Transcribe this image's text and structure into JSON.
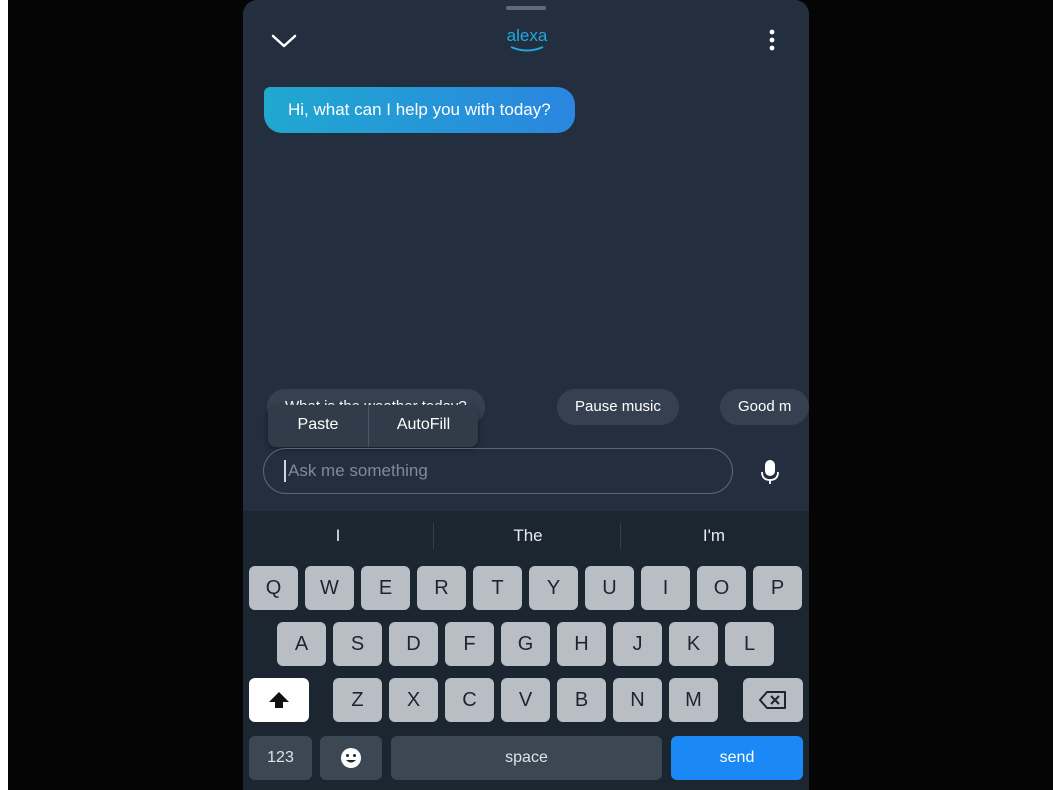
{
  "header": {
    "logo_text": "alexa",
    "collapse_icon": "chevron-down-icon",
    "more_icon": "more-vertical-icon"
  },
  "conversation": {
    "assistant_message": "Hi, what can I help you with today?"
  },
  "suggestion_chips": [
    "What is the weather today?",
    "Pause music",
    "Good m"
  ],
  "context_menu": {
    "paste_label": "Paste",
    "autofill_label": "AutoFill"
  },
  "input": {
    "placeholder": "Ask me something",
    "mic_icon": "microphone-icon"
  },
  "keyboard": {
    "predictions": [
      "I",
      "The",
      "I'm"
    ],
    "row1": [
      "Q",
      "W",
      "E",
      "R",
      "T",
      "Y",
      "U",
      "I",
      "O",
      "P"
    ],
    "row2": [
      "A",
      "S",
      "D",
      "F",
      "G",
      "H",
      "J",
      "K",
      "L"
    ],
    "row3": [
      "Z",
      "X",
      "C",
      "V",
      "B",
      "N",
      "M"
    ],
    "numbers_label": "123",
    "space_label": "space",
    "send_label": "send"
  },
  "colors": {
    "background": "#232f3e",
    "accent": "#1a88f5",
    "bubble_start": "#20a8cf",
    "bubble_end": "#2a86e0"
  }
}
